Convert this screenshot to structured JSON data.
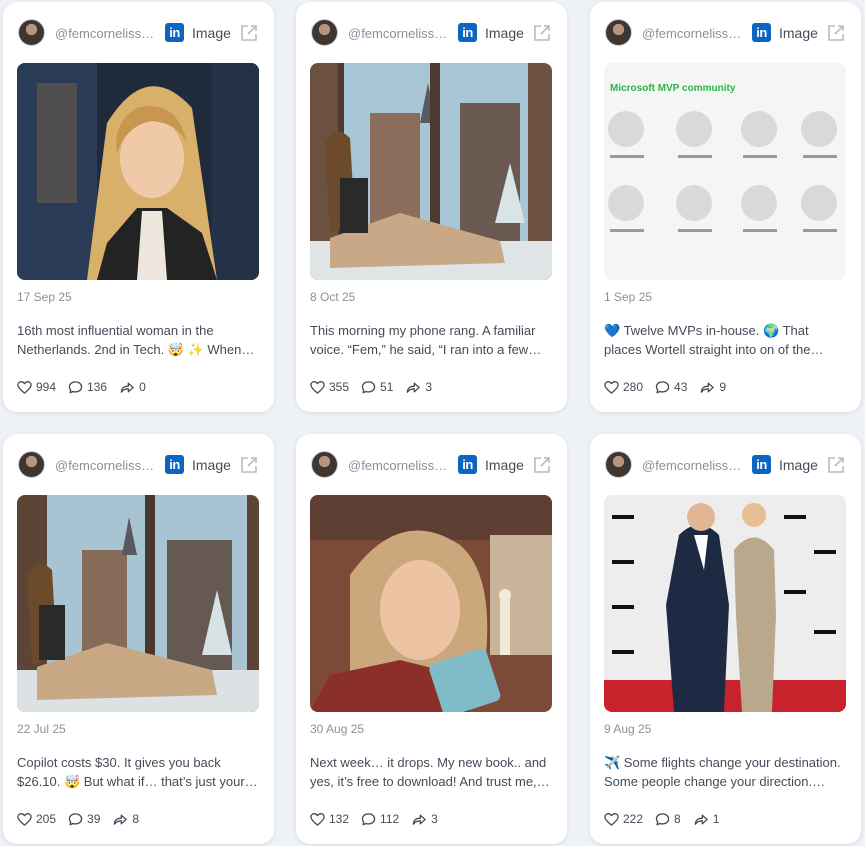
{
  "colors": {
    "linkedin": "#0a66c2",
    "background": "#eef1f6",
    "card": "#ffffff"
  },
  "posts": [
    {
      "handle": "@femcornelissen",
      "platform": "linkedin-icon",
      "type": "Image",
      "date": "17 Sep 25",
      "caption": "16th most influential woman in the Netherlands. 2nd in Tech. 🤯 ✨ When I…",
      "likes": "994",
      "comments": "136",
      "shares": "0"
    },
    {
      "handle": "@femcornelissen",
      "platform": "linkedin-icon",
      "type": "Image",
      "date": "8 Oct 25",
      "caption": "This morning my phone rang. A familiar voice. “Fem,” he said, “I ran into a few of…",
      "likes": "355",
      "comments": "51",
      "shares": "3"
    },
    {
      "handle": "@femcornelissen",
      "platform": "linkedin-icon",
      "type": "Image",
      "date": "1 Sep 25",
      "caption": "💙 Twelve MVPs in-house. 🌍 That places Wortell straight into on of the global top…",
      "likes": "280",
      "comments": "43",
      "shares": "9",
      "media_title": "Microsoft MVP community"
    },
    {
      "handle": "@femcornelissen",
      "platform": "linkedin-icon",
      "type": "Image",
      "date": "22 Jul 25",
      "caption": "Copilot costs $30. It gives you back $26.10. 🤯 But what if… that’s just your…",
      "likes": "205",
      "comments": "39",
      "shares": "8"
    },
    {
      "handle": "@femcornelissen",
      "platform": "linkedin-icon",
      "type": "Image",
      "date": "30 Aug 25",
      "caption": "Next week… it drops. My new book.. and yes, it’s free to download! And trust me,…",
      "likes": "132",
      "comments": "112",
      "shares": "3"
    },
    {
      "handle": "@femcornelissen",
      "platform": "linkedin-icon",
      "type": "Image",
      "date": "9 Aug 25",
      "caption": "✈️ Some flights change your destination. Some people change your direction. For…",
      "likes": "222",
      "comments": "8",
      "shares": "1"
    }
  ]
}
